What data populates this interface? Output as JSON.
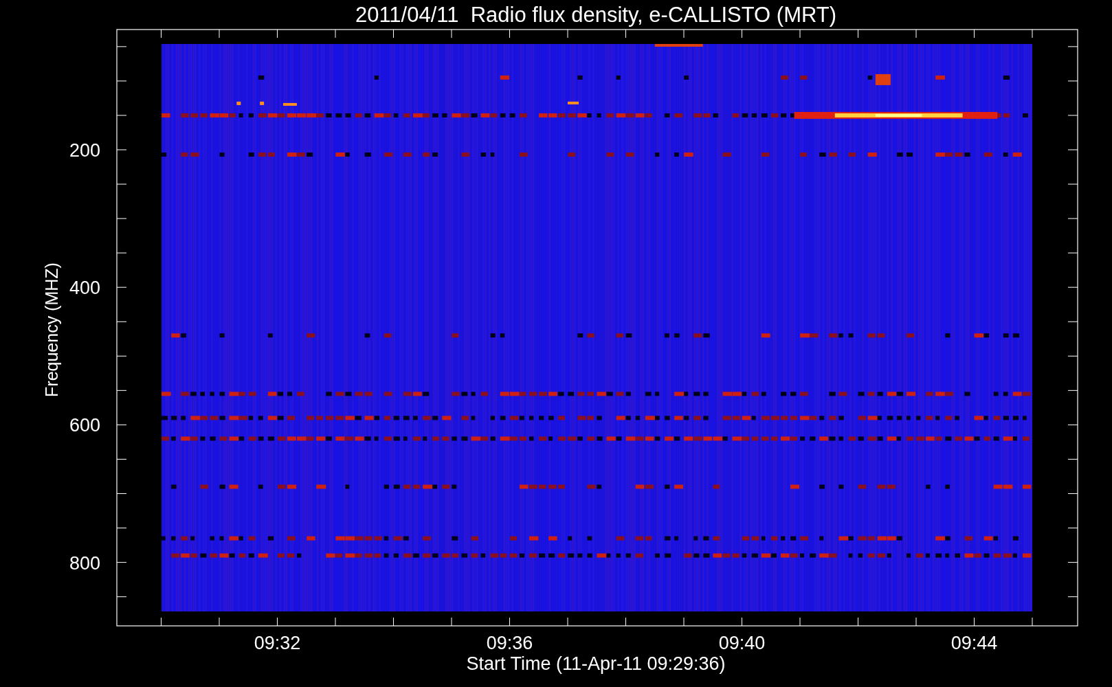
{
  "plot": {
    "title": "2011/04/11  Radio flux density, e-CALLISTO (MRT)",
    "y_label": "Frequency (MHZ)",
    "x_label": "Start Time (11-Apr-11 09:29:36)",
    "y_tick_labels": [
      "200",
      "400",
      "600",
      "800"
    ],
    "x_tick_labels": [
      "09:32",
      "09:36",
      "09:40",
      "09:44"
    ]
  }
}
